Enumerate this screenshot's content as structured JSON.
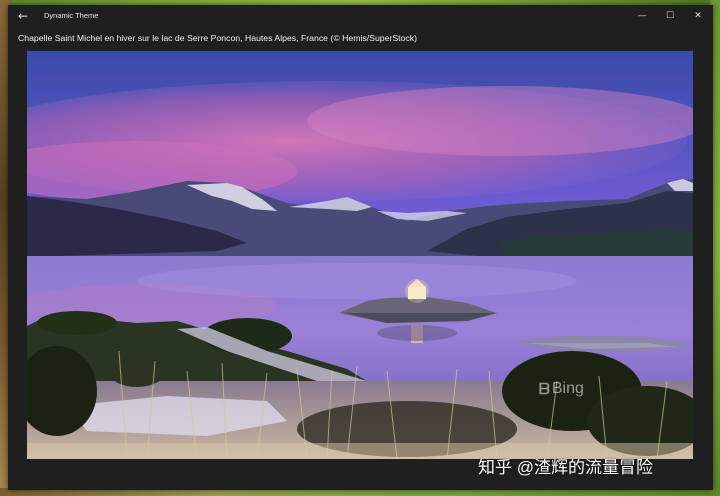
{
  "window": {
    "app_title": "Dynamic Theme",
    "back_icon": "arrow-left-icon",
    "controls": {
      "minimize": "—",
      "maximize": "☐",
      "close": "✕"
    }
  },
  "image": {
    "caption": "Chapelle Saint Michel en hiver sur le lac de Serre Poncon, Hautes Alpes, France (© Hemis/SuperStock)",
    "bing_logo": "Bing"
  },
  "watermark": "知乎 @渣辉的流量冒险"
}
